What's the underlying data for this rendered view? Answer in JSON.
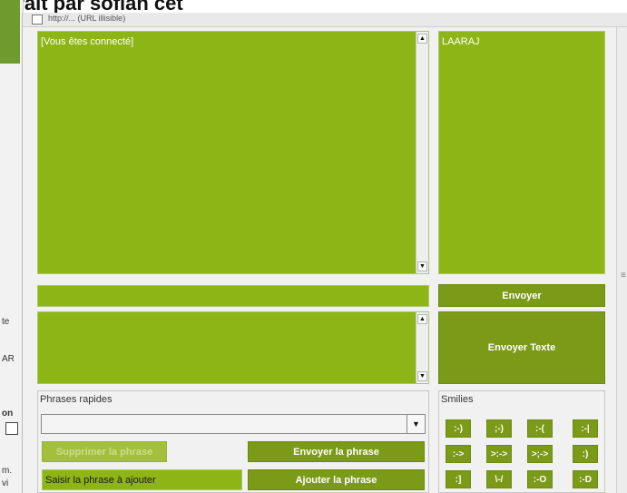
{
  "caption": "...rait par sofian cet",
  "background": {
    "left_labels": [
      "te",
      "AR",
      "on",
      "m.",
      "vi"
    ]
  },
  "window": {
    "url": "http://... (URL illisible)"
  },
  "chat": {
    "status_text": "[Vous êtes connecté]",
    "message_input_value": "",
    "send_label": "Envoyer",
    "send_text_label": "Envoyer Texte"
  },
  "users": [
    "LAARAJ"
  ],
  "quick_phrases": {
    "title": "Phrases rapides",
    "selected": "",
    "delete_label": "Supprimer la phrase",
    "send_phrase_label": "Envoyer la phrase",
    "add_input_value": "Saisir la phrase à ajouter",
    "add_phrase_label": "Ajouter la phrase"
  },
  "smilies": {
    "title": "Smilies",
    "items": [
      ":-)",
      ";-)",
      ":-(",
      ":-|",
      ":->",
      ">:->",
      ">;->",
      ":)",
      ":]",
      "\\-/",
      ":-O",
      ":-D"
    ]
  },
  "icons": {
    "scroll_up": "triangle-up",
    "scroll_down": "triangle-down",
    "combo": "triangle-down"
  },
  "colors": {
    "pane_green": "#8db515",
    "button_green": "#7b9a18"
  }
}
